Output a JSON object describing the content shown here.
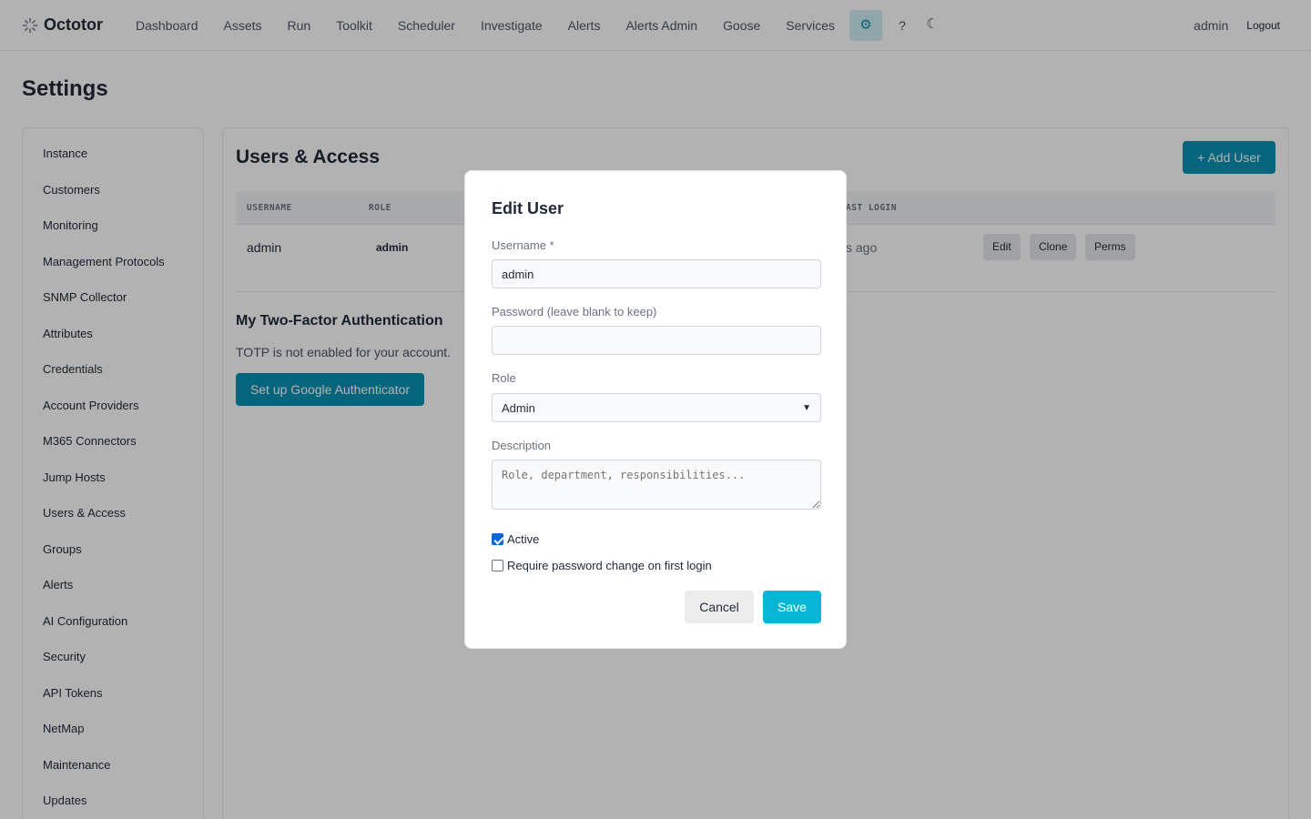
{
  "app": {
    "name": "Octotor",
    "logo_icon": "sunburst-logo-icon",
    "nav": [
      "Dashboard",
      "Assets",
      "Run",
      "Toolkit",
      "Scheduler",
      "Investigate",
      "Alerts",
      "Alerts Admin",
      "Goose",
      "Services"
    ],
    "settings_icon": "⚙",
    "help_label": "?",
    "theme_icon": "☾",
    "user": "admin",
    "logout_label": "Logout"
  },
  "page": {
    "title": "Settings"
  },
  "sidebar": {
    "items": [
      "Instance",
      "Customers",
      "Monitoring",
      "Management Protocols",
      "SNMP Collector",
      "Attributes",
      "Credentials",
      "Account Providers",
      "M365 Connectors",
      "Jump Hosts",
      "Users & Access",
      "Groups",
      "Alerts",
      "AI Configuration",
      "Security",
      "API Tokens",
      "NetMap",
      "Maintenance",
      "Updates"
    ],
    "active": "Users & Access"
  },
  "main": {
    "title": "Users & Access",
    "add_user_label": "+ Add User",
    "table": {
      "headers": {
        "username": "USERNAME",
        "role": "ROLE",
        "last_login": "AST LOGIN"
      },
      "row": {
        "username": "admin",
        "role": "admin",
        "last_login": "s ago",
        "actions": [
          "Edit",
          "Clone",
          "Perms"
        ]
      }
    },
    "tfa": {
      "title": "My Two-Factor Authentication",
      "text": "TOTP is not enabled for your account.",
      "button_label": "Set up Google Authenticator"
    }
  },
  "modal": {
    "title": "Edit User",
    "username_label": "Username *",
    "username_value": "admin",
    "password_label": "Password (leave blank to keep)",
    "password_value": "",
    "role_label": "Role",
    "role_value": "Admin",
    "description_label": "Description",
    "description_placeholder": "Role, department, responsibilities...",
    "active_label": "Active",
    "active_checked": true,
    "require_pw_label": "Require password change on first login",
    "require_pw_checked": false,
    "cancel_label": "Cancel",
    "save_label": "Save"
  },
  "colors": {
    "accent": "#0891b2",
    "save": "#06b6d4",
    "checkbox": "#0a66d8"
  }
}
